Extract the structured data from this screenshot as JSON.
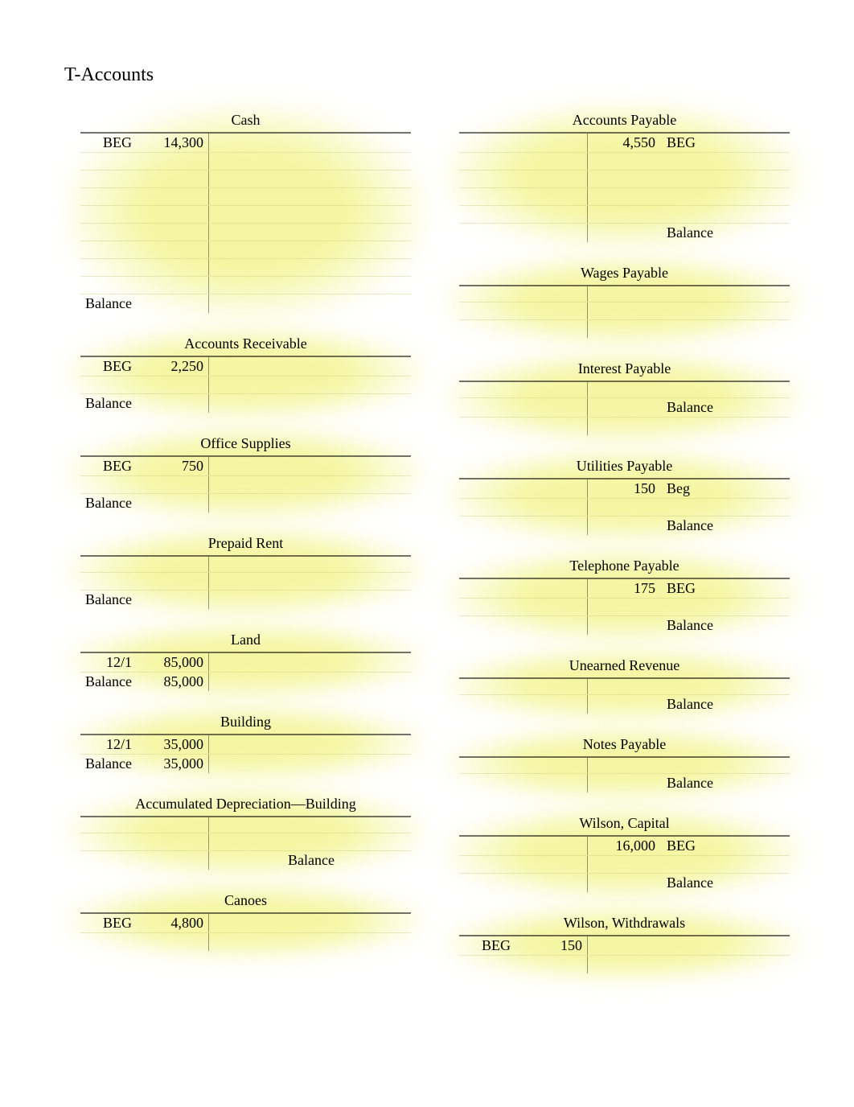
{
  "page_title": "T-Accounts",
  "left": [
    {
      "title": "Cash",
      "rows": [
        {
          "lt": "BEG",
          "dr": "14,300",
          "cr": "",
          "rt": ""
        },
        {
          "lt": "",
          "dr": "",
          "cr": "",
          "rt": ""
        },
        {
          "lt": "",
          "dr": "",
          "cr": "",
          "rt": ""
        },
        {
          "lt": "",
          "dr": "",
          "cr": "",
          "rt": ""
        },
        {
          "lt": "",
          "dr": "",
          "cr": "",
          "rt": ""
        },
        {
          "lt": "",
          "dr": "",
          "cr": "",
          "rt": ""
        },
        {
          "lt": "",
          "dr": "",
          "cr": "",
          "rt": ""
        },
        {
          "lt": "",
          "dr": "",
          "cr": "",
          "rt": ""
        },
        {
          "lt": "",
          "dr": "",
          "cr": "",
          "rt": ""
        },
        {
          "lt": "Balance",
          "dr": "",
          "cr": "",
          "rt": ""
        }
      ]
    },
    {
      "title": "Accounts Receivable",
      "rows": [
        {
          "lt": "BEG",
          "dr": "2,250",
          "cr": "",
          "rt": ""
        },
        {
          "lt": "",
          "dr": "",
          "cr": "",
          "rt": ""
        },
        {
          "lt": "Balance",
          "dr": "",
          "cr": "",
          "rt": ""
        }
      ]
    },
    {
      "title": "Office Supplies",
      "rows": [
        {
          "lt": "BEG",
          "dr": "750",
          "cr": "",
          "rt": ""
        },
        {
          "lt": "",
          "dr": "",
          "cr": "",
          "rt": ""
        },
        {
          "lt": "Balance",
          "dr": "",
          "cr": "",
          "rt": ""
        }
      ]
    },
    {
      "title": "Prepaid Rent",
      "rows": [
        {
          "lt": "",
          "dr": "",
          "cr": "",
          "rt": ""
        },
        {
          "lt": "",
          "dr": "",
          "cr": "",
          "rt": ""
        },
        {
          "lt": "Balance",
          "dr": "",
          "cr": "",
          "rt": ""
        }
      ]
    },
    {
      "title": "Land",
      "rows": [
        {
          "lt": "12/1",
          "dr": "85,000",
          "cr": "",
          "rt": ""
        },
        {
          "lt": "Balance",
          "dr": "85,000",
          "cr": "",
          "rt": ""
        }
      ]
    },
    {
      "title": "Building",
      "rows": [
        {
          "lt": "12/1",
          "dr": "35,000",
          "cr": "",
          "rt": ""
        },
        {
          "lt": "Balance",
          "dr": "35,000",
          "cr": "",
          "rt": ""
        }
      ]
    },
    {
      "title": "Accumulated Depreciation—Building",
      "rows": [
        {
          "lt": "",
          "dr": "",
          "cr": "",
          "rt": ""
        },
        {
          "lt": "",
          "dr": "",
          "cr": "",
          "rt": ""
        },
        {
          "lt": "",
          "dr": "",
          "cr": "",
          "rt": "Balance"
        }
      ]
    },
    {
      "title": "Canoes",
      "rows": [
        {
          "lt": "BEG",
          "dr": "4,800",
          "cr": "",
          "rt": ""
        },
        {
          "lt": "",
          "dr": "",
          "cr": "",
          "rt": ""
        }
      ]
    }
  ],
  "right": [
    {
      "title": "Accounts Payable",
      "rows": [
        {
          "lt": "",
          "dr": "",
          "cr": "4,550",
          "rt": "BEG"
        },
        {
          "lt": "",
          "dr": "",
          "cr": "",
          "rt": ""
        },
        {
          "lt": "",
          "dr": "",
          "cr": "",
          "rt": ""
        },
        {
          "lt": "",
          "dr": "",
          "cr": "",
          "rt": ""
        },
        {
          "lt": "",
          "dr": "",
          "cr": "",
          "rt": ""
        },
        {
          "lt": "",
          "dr": "",
          "cr": "",
          "rt": "Balance"
        }
      ]
    },
    {
      "title": "Wages Payable",
      "rows": [
        {
          "lt": "",
          "dr": "",
          "cr": "",
          "rt": ""
        },
        {
          "lt": "",
          "dr": "",
          "cr": "",
          "rt": ""
        },
        {
          "lt": "",
          "dr": "",
          "cr": "",
          "rt": ""
        }
      ]
    },
    {
      "title": "Interest Payable",
      "rows": [
        {
          "lt": "",
          "dr": "",
          "cr": "",
          "rt": ""
        },
        {
          "lt": "",
          "dr": "",
          "cr": "",
          "rt": "Balance"
        },
        {
          "lt": "",
          "dr": "",
          "cr": "",
          "rt": ""
        }
      ]
    },
    {
      "title": "Utilities Payable",
      "rows": [
        {
          "lt": "",
          "dr": "",
          "cr": "150",
          "rt": "Beg"
        },
        {
          "lt": "",
          "dr": "",
          "cr": "",
          "rt": ""
        },
        {
          "lt": "",
          "dr": "",
          "cr": "",
          "rt": "Balance"
        }
      ]
    },
    {
      "title": "Telephone Payable",
      "rows": [
        {
          "lt": "",
          "dr": "",
          "cr": "175",
          "rt": "BEG"
        },
        {
          "lt": "",
          "dr": "",
          "cr": "",
          "rt": ""
        },
        {
          "lt": "",
          "dr": "",
          "cr": "",
          "rt": "Balance"
        }
      ]
    },
    {
      "title": "Unearned Revenue",
      "rows": [
        {
          "lt": "",
          "dr": "",
          "cr": "",
          "rt": ""
        },
        {
          "lt": "",
          "dr": "",
          "cr": "",
          "rt": "Balance"
        }
      ]
    },
    {
      "title": "Notes Payable",
      "rows": [
        {
          "lt": "",
          "dr": "",
          "cr": "",
          "rt": ""
        },
        {
          "lt": "",
          "dr": "",
          "cr": "",
          "rt": "Balance"
        }
      ]
    },
    {
      "title": "Wilson, Capital",
      "rows": [
        {
          "lt": "",
          "dr": "",
          "cr": "16,000",
          "rt": "BEG"
        },
        {
          "lt": "",
          "dr": "",
          "cr": "",
          "rt": ""
        },
        {
          "lt": "",
          "dr": "",
          "cr": "",
          "rt": "Balance"
        }
      ]
    },
    {
      "title": "Wilson, Withdrawals",
      "rows": [
        {
          "lt": "BEG",
          "dr": "150",
          "cr": "",
          "rt": ""
        },
        {
          "lt": "",
          "dr": "",
          "cr": "",
          "rt": ""
        }
      ]
    }
  ]
}
